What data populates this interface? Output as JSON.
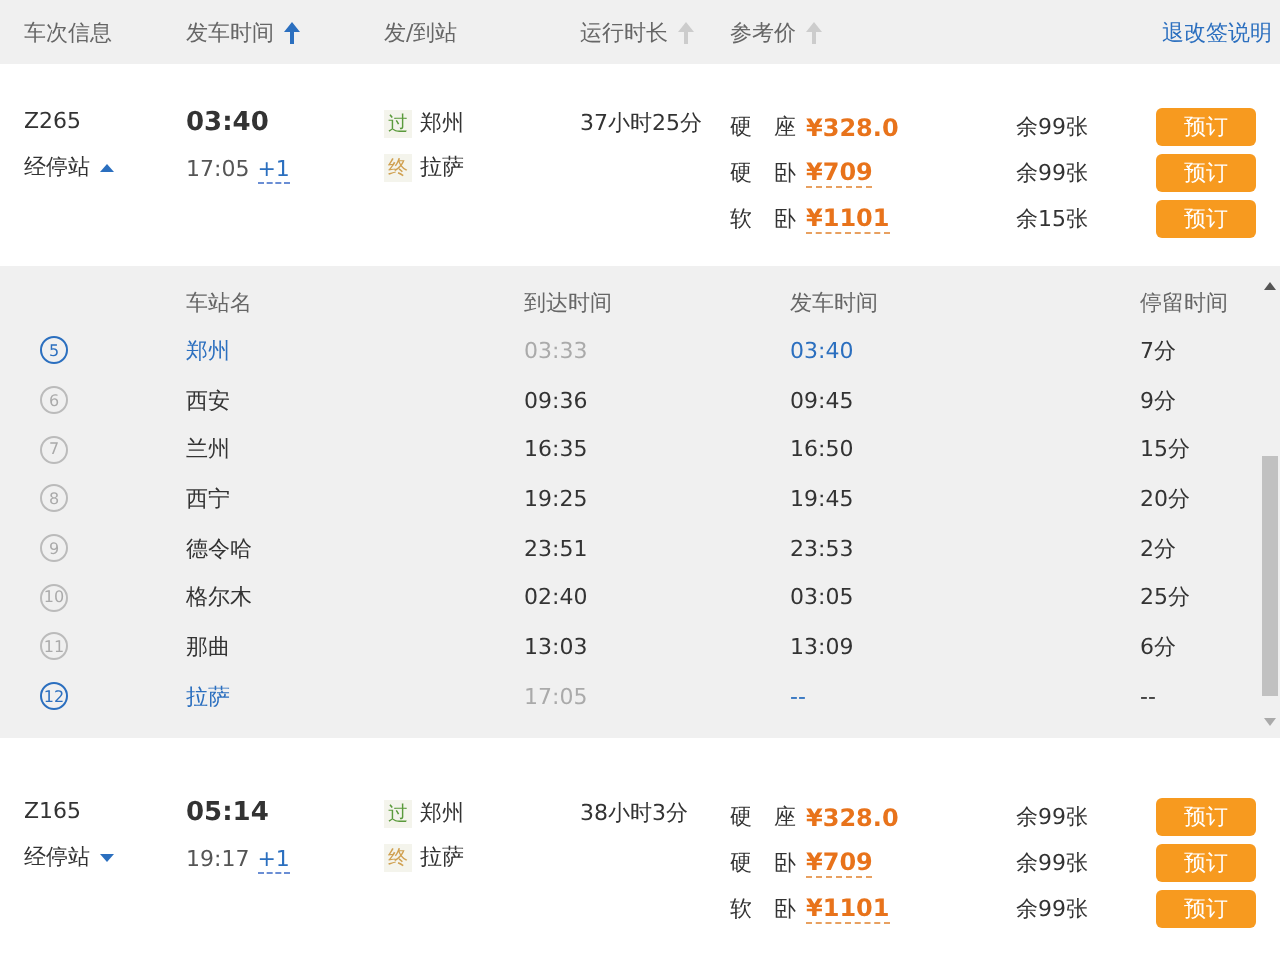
{
  "header": {
    "columns": [
      {
        "label": "车次信息",
        "sortable": false
      },
      {
        "label": "发车时间",
        "sortable": true,
        "selected": true
      },
      {
        "label": "发/到站",
        "sortable": false
      },
      {
        "label": "运行时长",
        "sortable": true,
        "selected": false
      },
      {
        "label": "参考价",
        "sortable": true,
        "selected": false
      }
    ],
    "link": "退改签说明"
  },
  "trains": [
    {
      "number": "Z265",
      "stops_label": "经停站",
      "expanded": true,
      "depart": "03:40",
      "arrive": "17:05",
      "day_offset": "+1",
      "from_tag": "过",
      "from": "郑州",
      "to_tag": "终",
      "to": "拉萨",
      "duration": "37小时25分",
      "seats": [
        {
          "type": "硬　座",
          "price": "¥328.0",
          "remaining": "余99张",
          "button": "预订"
        },
        {
          "type": "硬　卧",
          "price": "¥709",
          "remaining": "余99张",
          "button": "预订"
        },
        {
          "type": "软　卧",
          "price": "¥1101",
          "remaining": "余15张",
          "button": "预订"
        }
      ],
      "stop_columns": [
        "车站名",
        "到达时间",
        "发车时间",
        "停留时间"
      ],
      "stops": [
        {
          "index": "5",
          "name": "郑州",
          "arrive": "03:33",
          "depart": "03:40",
          "stay": "7分",
          "highlighted": true
        },
        {
          "index": "6",
          "name": "西安",
          "arrive": "09:36",
          "depart": "09:45",
          "stay": "9分",
          "highlighted": false
        },
        {
          "index": "7",
          "name": "兰州",
          "arrive": "16:35",
          "depart": "16:50",
          "stay": "15分",
          "highlighted": false
        },
        {
          "index": "8",
          "name": "西宁",
          "arrive": "19:25",
          "depart": "19:45",
          "stay": "20分",
          "highlighted": false
        },
        {
          "index": "9",
          "name": "德令哈",
          "arrive": "23:51",
          "depart": "23:53",
          "stay": "2分",
          "highlighted": false
        },
        {
          "index": "10",
          "name": "格尔木",
          "arrive": "02:40",
          "depart": "03:05",
          "stay": "25分",
          "highlighted": false
        },
        {
          "index": "11",
          "name": "那曲",
          "arrive": "13:03",
          "depart": "13:09",
          "stay": "6分",
          "highlighted": false
        },
        {
          "index": "12",
          "name": "拉萨",
          "arrive": "17:05",
          "depart": "--",
          "stay": "--",
          "highlighted": true
        }
      ]
    },
    {
      "number": "Z165",
      "stops_label": "经停站",
      "expanded": false,
      "depart": "05:14",
      "arrive": "19:17",
      "day_offset": "+1",
      "from_tag": "过",
      "from": "郑州",
      "to_tag": "终",
      "to": "拉萨",
      "duration": "38小时3分",
      "seats": [
        {
          "type": "硬　座",
          "price": "¥328.0",
          "remaining": "余99张",
          "button": "预订"
        },
        {
          "type": "硬　卧",
          "price": "¥709",
          "remaining": "余99张",
          "button": "预订"
        },
        {
          "type": "软　卧",
          "price": "¥1101",
          "remaining": "余99张",
          "button": "预订"
        }
      ]
    }
  ]
}
